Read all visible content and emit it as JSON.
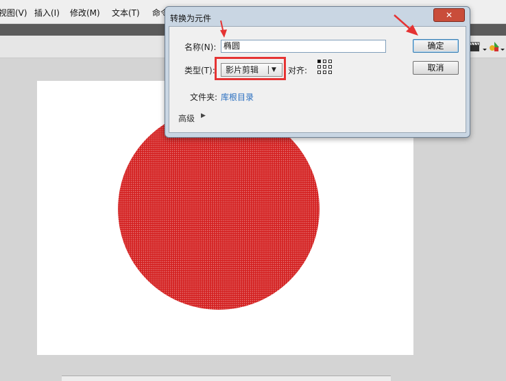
{
  "menubar": {
    "items": [
      "视图(V)",
      "插入(I)",
      "修改(M)",
      "文本(T)",
      "命令"
    ]
  },
  "dialog": {
    "title": "转换为元件",
    "close_label": "✕",
    "name_label": "名称(N):",
    "name_value": "椭圆",
    "type_label": "类型(T):",
    "type_value": "影片剪辑",
    "align_label": "对齐:",
    "folder_label": "文件夹:",
    "folder_link": "库根目录",
    "advanced_label": "高级",
    "ok_label": "确定",
    "cancel_label": "取消"
  },
  "stage": {
    "shape_color": "#d42222"
  },
  "colors": {
    "annotation": "#e53333",
    "link": "#2a6fc0"
  },
  "icons": [
    "clapper-icon",
    "shapes-icon",
    "dropdown-arrow-icon",
    "align-grid-icon",
    "expand-arrow-icon",
    "close-icon"
  ]
}
